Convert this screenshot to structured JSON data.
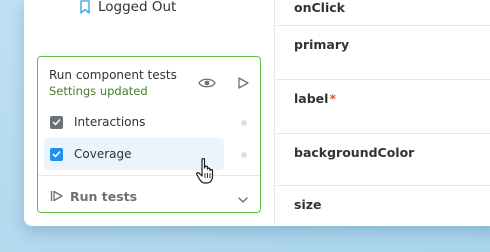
{
  "sidebar": {
    "items": [
      {
        "label": "Logged Out"
      }
    ]
  },
  "test_panel": {
    "title": "Run component tests",
    "status": "Settings updated",
    "options": [
      {
        "label": "Interactions",
        "checked": true,
        "checkbox_color": "#6b7178"
      },
      {
        "label": "Coverage",
        "checked": true,
        "checkbox_color": "#1e90f0",
        "highlighted": true
      }
    ],
    "run_label": "Run tests",
    "border_color": "#66bf3c",
    "status_color": "#448028"
  },
  "props_table": {
    "rows": [
      {
        "name": "onClick",
        "required_mark": ""
      },
      {
        "name": "primary",
        "required_mark": ""
      },
      {
        "name": "label",
        "required_mark": "*"
      },
      {
        "name": "backgroundColor",
        "required_mark": ""
      },
      {
        "name": "size",
        "required_mark": ""
      }
    ]
  }
}
